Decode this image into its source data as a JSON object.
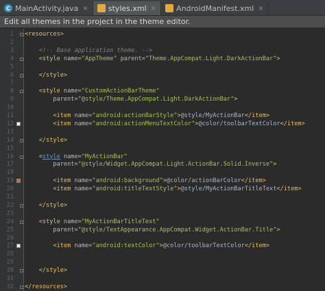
{
  "tabs": [
    {
      "label": "MainActivity.java",
      "icon": "java-class-icon",
      "active": false
    },
    {
      "label": "styles.xml",
      "icon": "xml-file-icon",
      "active": true
    },
    {
      "label": "AndroidManifest.xml",
      "icon": "manifest-file-icon",
      "active": false
    }
  ],
  "banner": {
    "text": "Edit all themes in the project in the theme editor."
  },
  "editor": {
    "lines": [
      {
        "n": "1",
        "tokens": [
          [
            "tag",
            "<resources>"
          ]
        ]
      },
      {
        "n": "2",
        "tokens": []
      },
      {
        "n": "3",
        "tokens": [
          [
            "plain",
            "    "
          ],
          [
            "cmt",
            "<!-- Base application theme. -->"
          ]
        ]
      },
      {
        "n": "4",
        "tokens": [
          [
            "plain",
            "    "
          ],
          [
            "tag",
            "<style "
          ],
          [
            "attr",
            "name="
          ],
          [
            "val",
            "\"AppTheme\" "
          ],
          [
            "attr",
            "parent="
          ],
          [
            "val",
            "\"Theme.AppCompat.Light.DarkActionBar\""
          ],
          [
            "tag",
            ">"
          ]
        ]
      },
      {
        "n": "5",
        "tokens": []
      },
      {
        "n": "6",
        "tokens": [
          [
            "plain",
            "    "
          ],
          [
            "tag",
            "</style>"
          ]
        ]
      },
      {
        "n": "7",
        "tokens": []
      },
      {
        "n": "8",
        "tokens": [
          [
            "plain",
            "    "
          ],
          [
            "tag",
            "<style "
          ],
          [
            "attr",
            "name="
          ],
          [
            "val",
            "\"CustomActionBarTheme\""
          ]
        ]
      },
      {
        "n": "9",
        "tokens": [
          [
            "plain",
            "        "
          ],
          [
            "attr",
            "parent="
          ],
          [
            "val",
            "\"@style/Theme.AppCompat.Light.DarkActionBar\""
          ],
          [
            "tag",
            ">"
          ]
        ]
      },
      {
        "n": "10",
        "tokens": []
      },
      {
        "n": "11",
        "tokens": [
          [
            "plain",
            "        "
          ],
          [
            "tag",
            "<item "
          ],
          [
            "attr",
            "name="
          ],
          [
            "val",
            "\"android:actionBarStyle\""
          ],
          [
            "tag",
            ">"
          ],
          [
            "plain",
            "@style/MyActionBar"
          ],
          [
            "tag",
            "</item>"
          ]
        ]
      },
      {
        "n": "12",
        "tokens": [
          [
            "plain",
            "        "
          ],
          [
            "tag",
            "<item "
          ],
          [
            "attr",
            "name="
          ],
          [
            "val",
            "\"android:actionMenuTextColor\""
          ],
          [
            "tag",
            ">"
          ],
          [
            "plain",
            "@color/toolbarTextColor"
          ],
          [
            "tag",
            "</item>"
          ]
        ]
      },
      {
        "n": "13",
        "tokens": []
      },
      {
        "n": "14",
        "tokens": [
          [
            "plain",
            "    "
          ],
          [
            "tag",
            "</style>"
          ]
        ]
      },
      {
        "n": "15",
        "tokens": []
      },
      {
        "n": "16",
        "tokens": [
          [
            "plain",
            "    "
          ],
          [
            "tag",
            "<"
          ],
          [
            "link",
            "style"
          ],
          [
            "plain",
            " "
          ],
          [
            "attr",
            "name="
          ],
          [
            "val",
            "\"MyActionBar\""
          ]
        ]
      },
      {
        "n": "17",
        "tokens": [
          [
            "plain",
            "        "
          ],
          [
            "attr",
            "parent="
          ],
          [
            "val",
            "\"@style/Widget.AppCompat.Light.ActionBar.Solid.Inverse\""
          ],
          [
            "tag",
            ">"
          ]
        ]
      },
      {
        "n": "18",
        "tokens": []
      },
      {
        "n": "19",
        "tokens": [
          [
            "plain",
            "        "
          ],
          [
            "tag",
            "<item "
          ],
          [
            "attr",
            "name="
          ],
          [
            "val",
            "\"android:background\""
          ],
          [
            "tag",
            ">"
          ],
          [
            "plain",
            "@color/actionBarColor"
          ],
          [
            "tag",
            "</item>"
          ]
        ]
      },
      {
        "n": "20",
        "tokens": [
          [
            "plain",
            "        "
          ],
          [
            "tag",
            "<item "
          ],
          [
            "attr",
            "name="
          ],
          [
            "val",
            "\"android:titleTextStyle\""
          ],
          [
            "tag",
            ">"
          ],
          [
            "plain",
            "@style/MyActionBarTitleText"
          ],
          [
            "tag",
            "</item>"
          ]
        ]
      },
      {
        "n": "21",
        "tokens": []
      },
      {
        "n": "22",
        "tokens": [
          [
            "plain",
            "    "
          ],
          [
            "tag",
            "</style>"
          ]
        ]
      },
      {
        "n": "23",
        "tokens": []
      },
      {
        "n": "24",
        "tokens": [
          [
            "plain",
            "    "
          ],
          [
            "tag",
            "<style "
          ],
          [
            "attr",
            "name="
          ],
          [
            "val",
            "\"MyActionBarTitleText\""
          ]
        ]
      },
      {
        "n": "25",
        "tokens": [
          [
            "plain",
            "        "
          ],
          [
            "attr",
            "parent="
          ],
          [
            "val",
            "\"@style/TextAppearance.AppCompat.Widget.ActionBar.Title\""
          ],
          [
            "tag",
            ">"
          ]
        ]
      },
      {
        "n": "26",
        "tokens": []
      },
      {
        "n": "27",
        "tokens": [
          [
            "plain",
            "        "
          ],
          [
            "tag",
            "<item "
          ],
          [
            "attr",
            "name="
          ],
          [
            "val",
            "\"android:textColor\""
          ],
          [
            "tag",
            ">"
          ],
          [
            "plain",
            "@color/toolbarTextColor"
          ],
          [
            "tag",
            "</item>"
          ]
        ]
      },
      {
        "n": "28",
        "tokens": []
      },
      {
        "n": "29",
        "tokens": []
      },
      {
        "n": "30",
        "tokens": [
          [
            "plain",
            "    "
          ],
          [
            "tag",
            "</style>"
          ]
        ]
      },
      {
        "n": "31",
        "tokens": []
      },
      {
        "n": "32",
        "tokens": [
          [
            "tag",
            "</resources>"
          ]
        ]
      }
    ],
    "color_markers": [
      {
        "line": "12",
        "color": "#f2f2f2"
      },
      {
        "line": "19",
        "color": "#d0682a"
      },
      {
        "line": "27",
        "color": "#f2f2f2"
      }
    ]
  }
}
